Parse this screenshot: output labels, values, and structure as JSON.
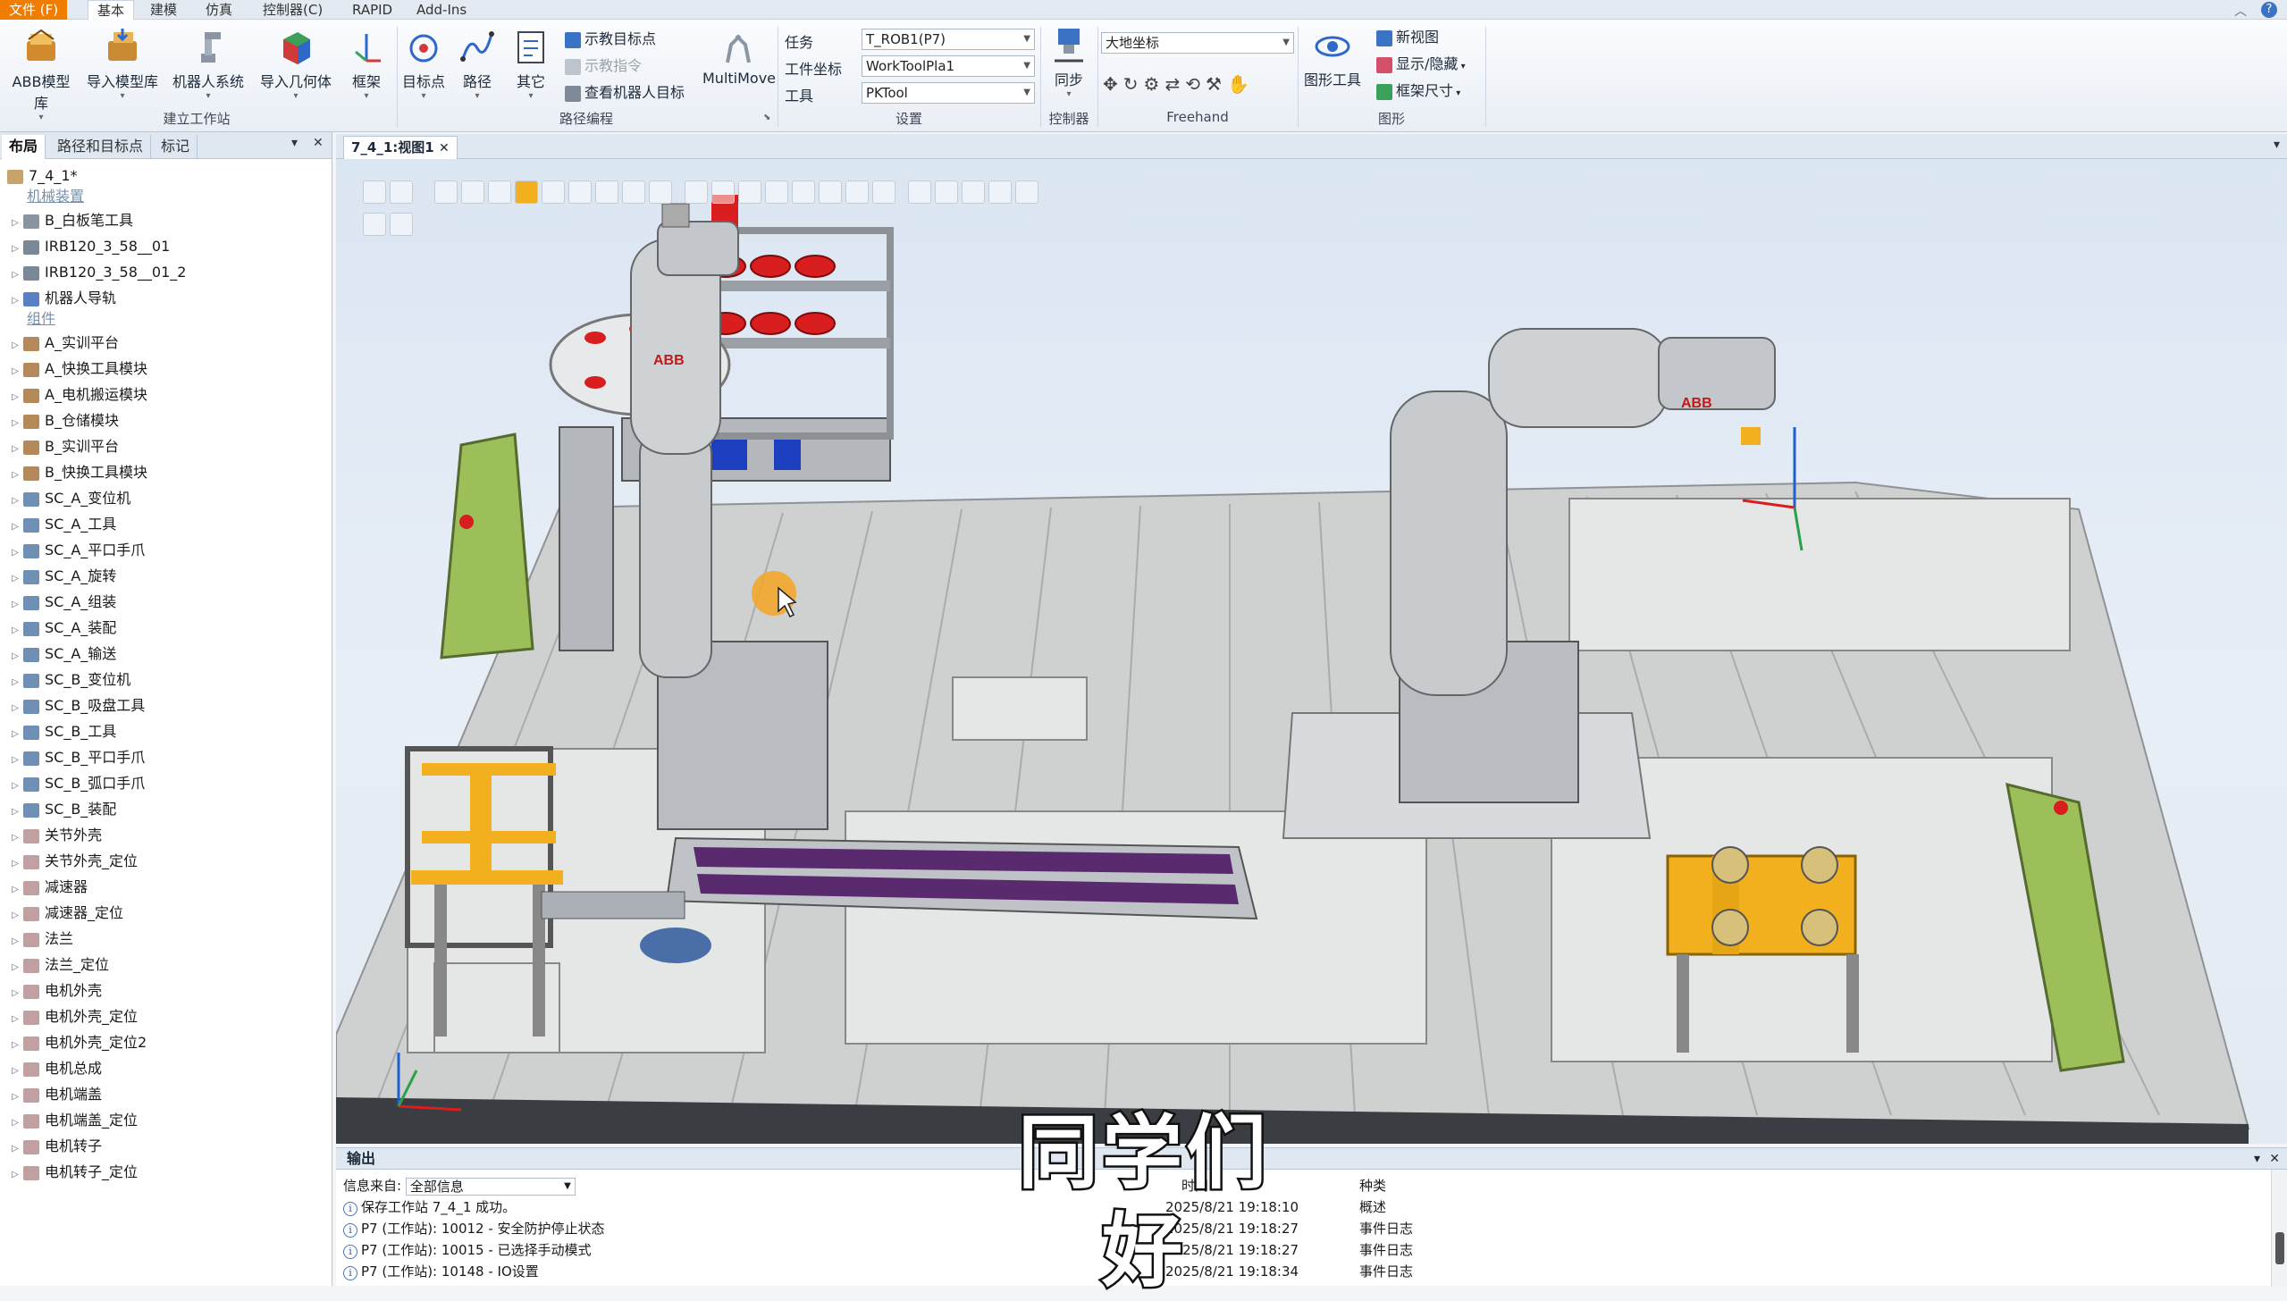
{
  "menu": {
    "file": "文件 (F)",
    "tabs": [
      "基本",
      "建模",
      "仿真",
      "控制器(C)",
      "RAPID",
      "Add-Ins"
    ]
  },
  "ribbon": {
    "build_station": {
      "group_label": "建立工作站",
      "abb_library": "ABB模型库",
      "import_library": "导入模型库",
      "robot_system": "机器人系统",
      "import_geometry": "导入几何体",
      "frame": "框架"
    },
    "path_programming": {
      "group_label": "路径编程",
      "target": "目标点",
      "path": "路径",
      "other": "其它",
      "teach_target": "示教目标点",
      "teach_instruction": "示教指令",
      "view_robot_target": "查看机器人目标",
      "multimove": "MultiMove"
    },
    "settings": {
      "group_label": "设置",
      "task_label": "任务",
      "task_value": "T_ROB1(P7)",
      "wobj_label": "工件坐标",
      "wobj_value": "WorkToolPla1",
      "tool_label": "工具",
      "tool_value": "PKTool"
    },
    "controller": {
      "group_label": "控制器",
      "sync": "同步"
    },
    "freehand": {
      "group_label": "Freehand",
      "coord_value": "大地坐标"
    },
    "graphics": {
      "group_label": "图形",
      "graphics_tools": "图形工具",
      "new_view": "新视图",
      "show_hide": "显示/隐藏",
      "frame_size": "框架尺寸"
    }
  },
  "left_panel": {
    "tabs": [
      "布局",
      "路径和目标点",
      "标记"
    ],
    "station": "7_4_1*",
    "mechanisms_label": "机械装置",
    "mechanisms": [
      "B_白板笔工具",
      "IRB120_3_58__01",
      "IRB120_3_58__01_2",
      "机器人导轨"
    ],
    "components_label": "组件",
    "components": [
      "A_实训平台",
      "A_快换工具模块",
      "A_电机搬运模块",
      "B_仓储模块",
      "B_实训平台",
      "B_快换工具模块",
      "SC_A_变位机",
      "SC_A_工具",
      "SC_A_平口手爪",
      "SC_A_旋转",
      "SC_A_组装",
      "SC_A_装配",
      "SC_A_输送",
      "SC_B_变位机",
      "SC_B_吸盘工具",
      "SC_B_工具",
      "SC_B_平口手爪",
      "SC_B_弧口手爪",
      "SC_B_装配",
      "关节外壳",
      "关节外壳_定位",
      "减速器",
      "减速器_定位",
      "法兰",
      "法兰_定位",
      "电机外壳",
      "电机外壳_定位",
      "电机外壳_定位2",
      "电机总成",
      "电机端盖",
      "电机端盖_定位",
      "电机转子",
      "电机转子_定位"
    ]
  },
  "document": {
    "tab": "7_4_1:视图1"
  },
  "scene": {
    "robot_logo": "ABB"
  },
  "output": {
    "title": "输出",
    "source_label": "信息来自:",
    "source_value": "全部信息",
    "time_header": "时间",
    "type_header": "种类",
    "rows": [
      {
        "message": "保存工作站 7_4_1 成功。",
        "time": "2025/8/21 19:18:10",
        "type": "概述"
      },
      {
        "message": "P7 (工作站): 10012 - 安全防护停止状态",
        "time": "2025/8/21 19:18:27",
        "type": "事件日志"
      },
      {
        "message": "P7 (工作站): 10015 - 已选择手动模式",
        "time": "2025/8/21 19:18:27",
        "type": "事件日志"
      },
      {
        "message": "P7 (工作站): 10148 - IO设置",
        "time": "2025/8/21 19:18:34",
        "type": "事件日志"
      }
    ]
  },
  "subtitle": "同学们好",
  "colors": {
    "file_menu": "#f07c00",
    "robot": "#b9bcc0",
    "yellow_fixture": "#f2b01e",
    "conveyor_belt": "#5a2a6e",
    "red_part": "#d81e1e",
    "hmi_panel": "#9cbf5a"
  }
}
